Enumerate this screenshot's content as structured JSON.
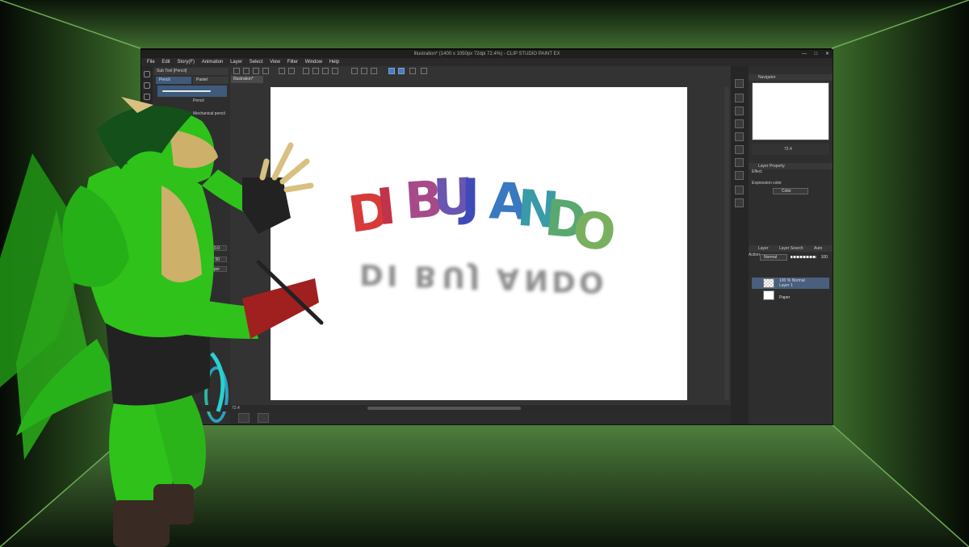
{
  "window": {
    "title": "Illustration* (1400 x 1050px 72dpi 72.4%) - CLIP STUDIO PAINT EX",
    "minimize": "—",
    "maximize": "□",
    "close": "✕"
  },
  "menu": [
    "File",
    "Edit",
    "Story(F)",
    "Animation",
    "Layer",
    "Select",
    "View",
    "Filter",
    "Window",
    "Help"
  ],
  "sub_tool": {
    "header": "Sub Tool [Pencil]",
    "tab_pencil": "Pencil",
    "tab_pastel": "Pastel",
    "brush_name": "Pencil",
    "brush_name2": "Mechanical pencil",
    "prop_values": [
      "10.0",
      "50",
      "Paper"
    ]
  },
  "canvas": {
    "doc_tab": "Illustration*",
    "zoom": "72.4",
    "rotation": "0.0",
    "title_text": "DIBUJANDO",
    "letter_colors": [
      "#d83a3a",
      "#c0334a",
      "#a64a8a",
      "#6a55b0",
      "#3f4ab8",
      "#3a78c0",
      "#3a9aa8",
      "#58a870",
      "#79b060"
    ]
  },
  "navigator": {
    "header": "Navigator",
    "zoom": "72.4",
    "angle": "0.0"
  },
  "layer_property": {
    "header": "Layer Property",
    "effect_label": "Effect",
    "expression_label": "Expression color",
    "expression_value": "Color"
  },
  "layers": {
    "tab_layer": "Layer",
    "tab_search": "Layer Search",
    "tab_auto": "Auto Action",
    "blend": "Normal",
    "opacity": "100",
    "items": [
      {
        "line1": "100 % Normal",
        "line2": "Layer 1",
        "selected": true
      },
      {
        "line1": "",
        "line2": "Paper",
        "selected": false
      }
    ]
  },
  "colors": {
    "room_green": "#4a7a3a",
    "app_bg": "#2b2b2b",
    "accent": "#4c7ab8",
    "character_green": "#2ec21a"
  }
}
